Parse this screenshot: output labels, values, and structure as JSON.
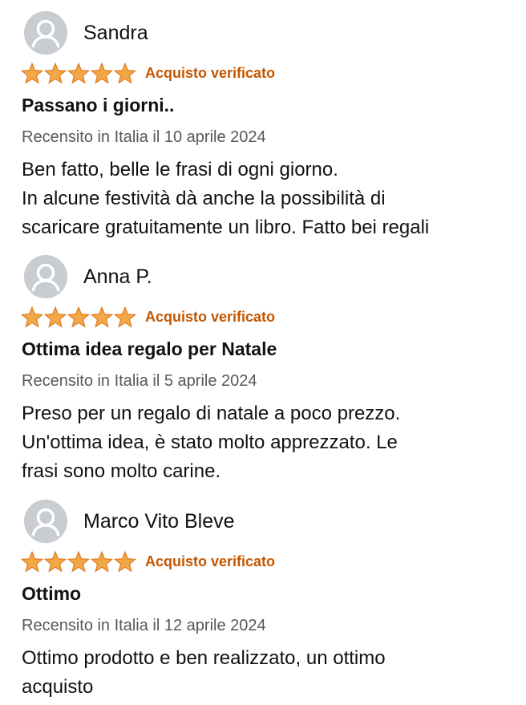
{
  "colors": {
    "star": "#f3a847",
    "verified": "#c45500",
    "meta": "#565959",
    "avatar_bg": "#c9cdd1"
  },
  "reviews": [
    {
      "author": "Sandra",
      "avatar_icon": "user-icon",
      "rating": 5,
      "verified_label": "Acquisto verificato",
      "title": "Passano i giorni..",
      "meta": "Recensito in Italia il 10 aprile 2024",
      "body_lines": [
        "Ben fatto, belle le frasi di ogni giorno.",
        "In alcune festività dà anche la possibilità di",
        "scaricare gratuitamente un libro. Fatto bei regali"
      ]
    },
    {
      "author": "Anna P.",
      "avatar_icon": "user-icon",
      "rating": 5,
      "verified_label": "Acquisto verificato",
      "title": "Ottima idea regalo per Natale",
      "meta": "Recensito in Italia il 5 aprile 2024",
      "body_lines": [
        "Preso per un regalo di natale a poco prezzo.",
        "Un'ottima idea, è stato molto apprezzato. Le",
        "frasi sono molto carine."
      ]
    },
    {
      "author": "Marco Vito Bleve",
      "avatar_icon": "user-icon",
      "rating": 5,
      "verified_label": "Acquisto verificato",
      "title": "Ottimo",
      "meta": "Recensito in Italia il 12 aprile 2024",
      "body_lines": [
        "Ottimo prodotto e ben realizzato, un ottimo",
        "acquisto"
      ]
    }
  ]
}
